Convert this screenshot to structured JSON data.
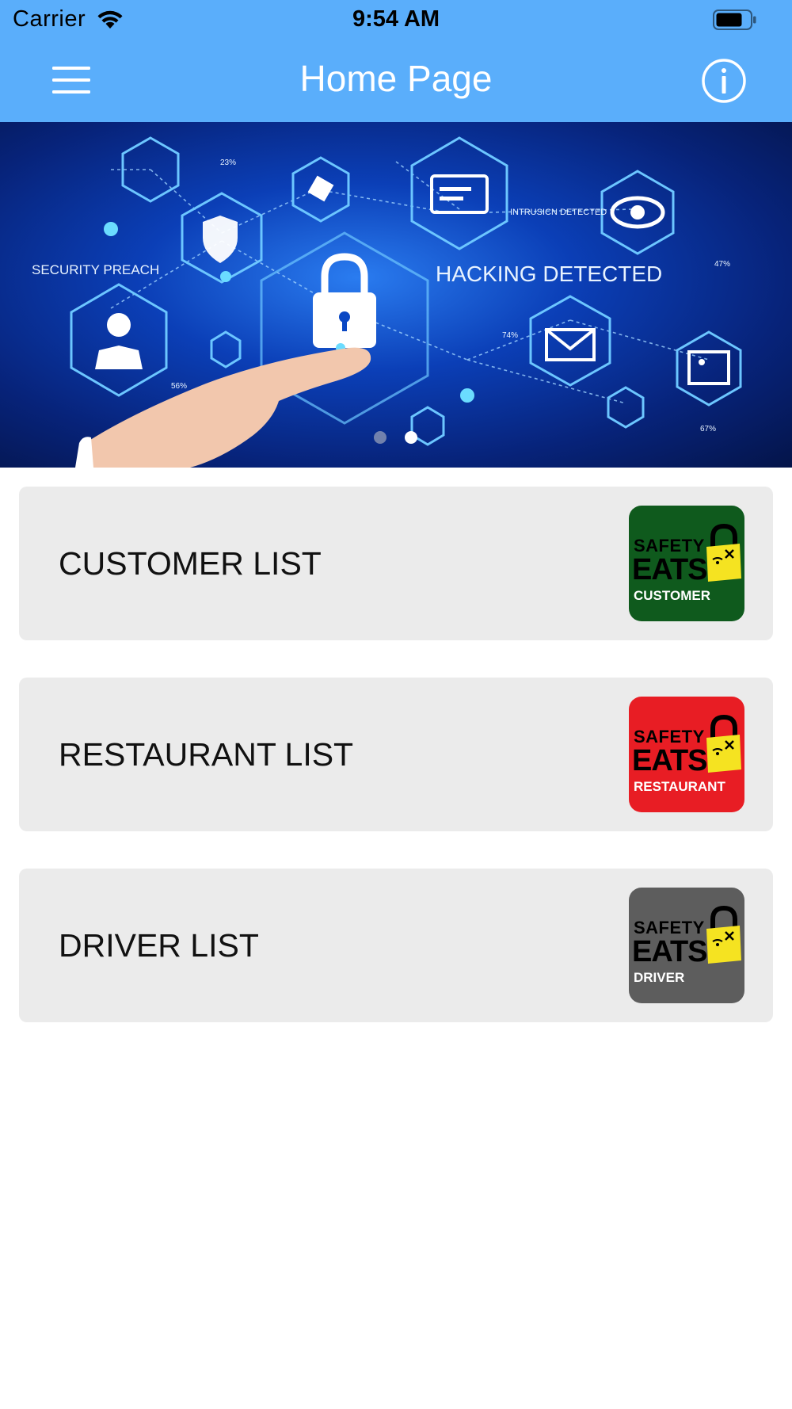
{
  "status_bar": {
    "carrier": "Carrier",
    "time": "9:54 AM"
  },
  "nav": {
    "title": "Home Page",
    "menu_icon": "hamburger-menu-icon",
    "info_icon": "info-icon"
  },
  "banner": {
    "labels": {
      "security": "SECURITY PREACH",
      "hacking": "HACKING DETECTED",
      "intrusion": "INTRUSICN DETECTED",
      "pct_23": "23%",
      "pct_47": "47%",
      "pct_56": "56%",
      "pct_74": "74%",
      "pct_67": "67%"
    },
    "pager": {
      "count": 2,
      "active": 2
    }
  },
  "cards": [
    {
      "label": "CUSTOMER LIST",
      "logo": {
        "line1": "SAFETY",
        "line2": "EATS",
        "line3": "CUSTOMER",
        "background": "#0f5a1d"
      }
    },
    {
      "label": "RESTAURANT LIST",
      "logo": {
        "line1": "SAFETY",
        "line2": "EATS",
        "line3": "RESTAURANT",
        "background": "#e81d24"
      }
    },
    {
      "label": "DRIVER LIST",
      "logo": {
        "line1": "SAFETY",
        "line2": "EATS",
        "line3": "DRIVER",
        "background": "#5d5d5d"
      }
    }
  ],
  "colors": {
    "header": "#5aaefb",
    "card_background": "#ebebeb",
    "lock_yellow": "#f5e321"
  }
}
